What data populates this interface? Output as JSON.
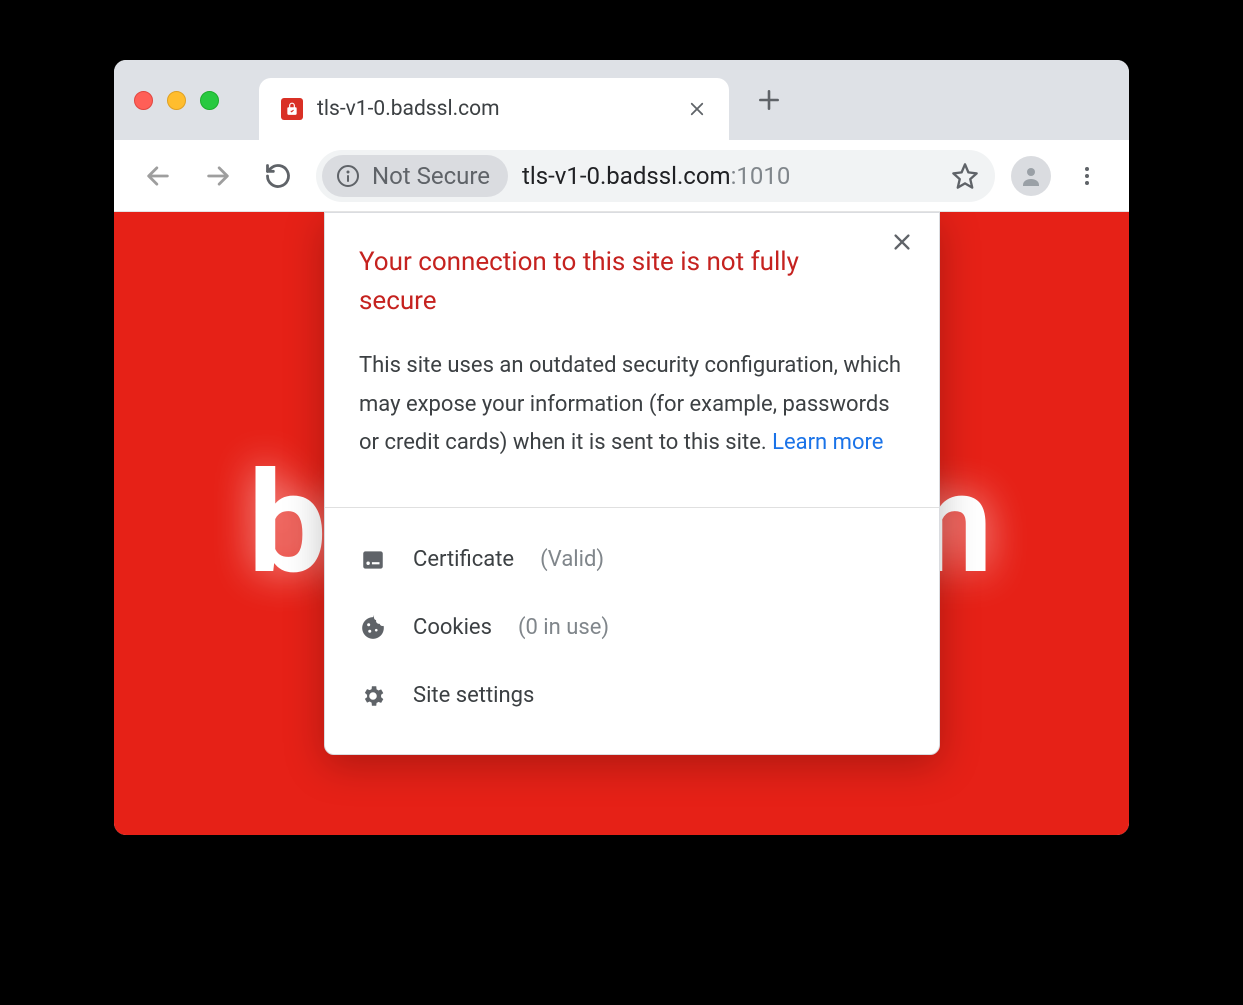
{
  "tab": {
    "title": "tls-v1-0.badssl.com"
  },
  "omnibox": {
    "security_label": "Not Secure",
    "url_host": "tls-v1-0.badssl.com",
    "url_port": ":1010"
  },
  "page": {
    "line1": "badssl.com"
  },
  "popup": {
    "title": "Your connection to this site is not fully secure",
    "body": "This site uses an outdated security configuration, which may expose your information (for example, passwords or credit cards) when it is sent to this site.",
    "learn_more": "Learn more",
    "certificate_label": "Certificate",
    "certificate_status": "(Valid)",
    "cookies_label": "Cookies",
    "cookies_status": "(0 in use)",
    "site_settings_label": "Site settings"
  }
}
